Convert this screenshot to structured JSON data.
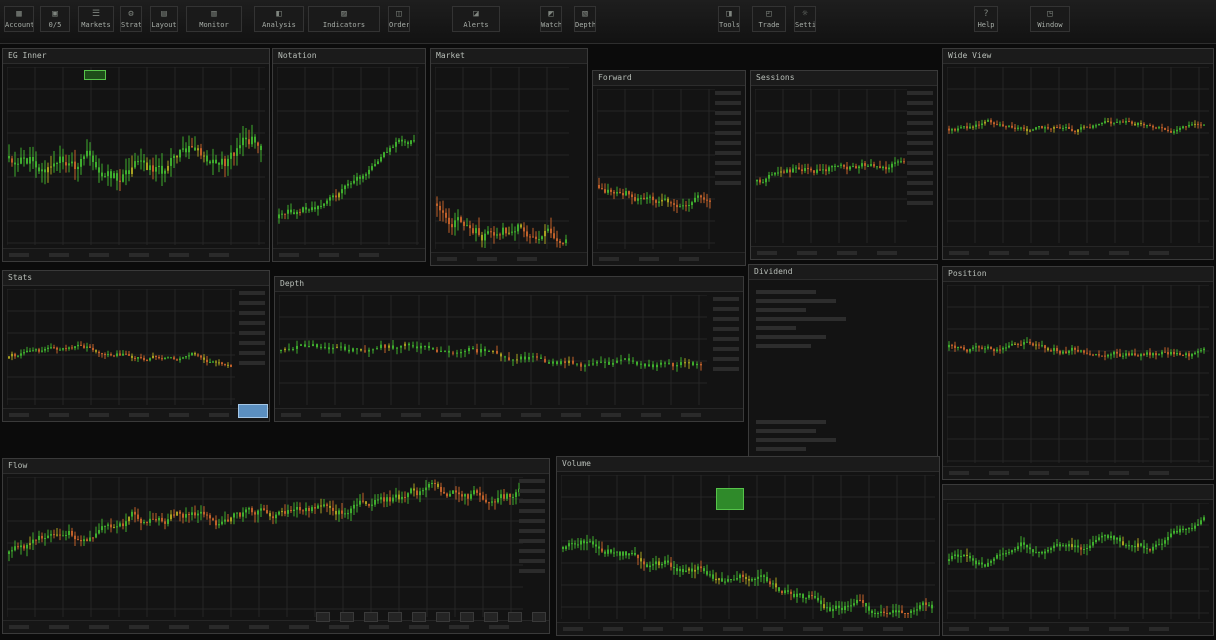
{
  "toolbar": {
    "buttons": [
      {
        "label": "Account",
        "icon": "chart-icon"
      },
      {
        "label": "0/5",
        "icon": "grid-icon"
      },
      {
        "label": "Markets",
        "icon": "list-icon"
      },
      {
        "label": "Strategy",
        "icon": "settings-icon"
      },
      {
        "label": "Layout",
        "icon": "layout-icon"
      },
      {
        "label": "Monitor",
        "icon": "monitor-icon"
      },
      {
        "label": "Analysis",
        "icon": "analysis-icon"
      },
      {
        "label": "Indicators",
        "icon": "indicator-icon"
      },
      {
        "label": "Orders",
        "icon": "orders-icon"
      },
      {
        "label": "Alerts",
        "icon": "alerts-icon"
      },
      {
        "label": "Watch",
        "icon": "watch-icon"
      },
      {
        "label": "Depth",
        "icon": "depth-icon"
      },
      {
        "label": "Tools",
        "icon": "tools-icon"
      },
      {
        "label": "Trade",
        "icon": "trade-icon"
      },
      {
        "label": "Settings",
        "icon": "gear-icon"
      },
      {
        "label": "Help",
        "icon": "help-icon"
      },
      {
        "label": "Window",
        "icon": "window-icon"
      }
    ]
  },
  "panels": [
    {
      "id": "p1",
      "title": "EG Inner",
      "value": "",
      "series": "a"
    },
    {
      "id": "p2",
      "title": "Notation",
      "value": "",
      "series": "b"
    },
    {
      "id": "p3",
      "title": "Market",
      "value": "",
      "series": "c"
    },
    {
      "id": "p4",
      "title": "Forward",
      "value": "",
      "series": "d"
    },
    {
      "id": "p5",
      "title": "Sessions",
      "value": "",
      "series": "e"
    },
    {
      "id": "p6",
      "title": "Wide View",
      "value": "",
      "series": "f"
    },
    {
      "id": "p7",
      "title": "Stats",
      "value": "",
      "series": "g"
    },
    {
      "id": "p8",
      "title": "Depth",
      "value": "",
      "series": "h"
    },
    {
      "id": "p9",
      "title": "Dividend",
      "value": "",
      "series": "i"
    },
    {
      "id": "p10",
      "title": "Position",
      "value": "",
      "series": "j"
    },
    {
      "id": "p11",
      "title": "Flow",
      "value": "",
      "series": "k"
    },
    {
      "id": "p12",
      "title": "Volume",
      "value": "",
      "series": "l"
    }
  ],
  "colors": {
    "up": "#3fae2e",
    "down": "#c0602a",
    "neutral": "#a8a020",
    "grid": "#262626",
    "panel_bg": "#131313"
  }
}
